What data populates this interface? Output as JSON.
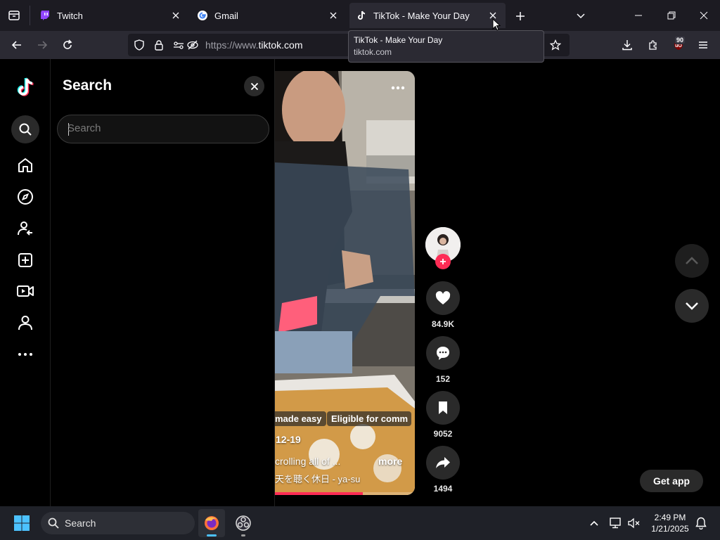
{
  "browser": {
    "tabs": [
      {
        "title": "Twitch"
      },
      {
        "title": "Gmail"
      },
      {
        "title": "TikTok - Make Your Day"
      }
    ],
    "url_prefix": "https://www.",
    "url_domain": "tiktok.com",
    "tooltip": {
      "title": "TikTok - Make Your Day",
      "domain": "tiktok.com"
    },
    "extension_badge": "90"
  },
  "sidebar": {
    "items": [
      "search-icon",
      "home-icon",
      "explore-icon",
      "following-icon",
      "upload-icon",
      "live-icon",
      "profile-icon",
      "more-icon"
    ]
  },
  "search_panel": {
    "title": "Search",
    "input_placeholder": "Search",
    "input_value": ""
  },
  "video": {
    "tag_1": "made easy",
    "tag_2": "Eligible for comm",
    "date": "12-19",
    "caption": "crolling all of ...",
    "more_label": "more",
    "music": "天を聴く休日 - ya-su",
    "progress": 0.63
  },
  "actions": {
    "likes": "84.9K",
    "comments": "152",
    "saves": "9052",
    "shares": "1494"
  },
  "get_app_label": "Get app",
  "taskbar": {
    "search_label": "Search",
    "time": "2:49 PM",
    "date": "1/21/2025"
  },
  "colors": {
    "accent": "#fe2c55",
    "tab_bg": "#1c1b22",
    "nav_bg": "#2b2a33"
  }
}
